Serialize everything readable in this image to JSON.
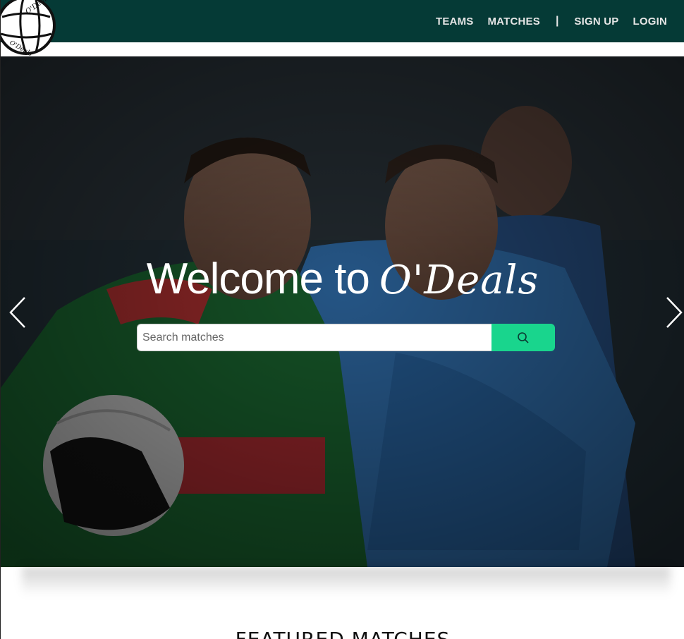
{
  "logo": {
    "icon": "gaelic-football-logo-icon",
    "text": "O'Deals"
  },
  "nav": {
    "items": [
      {
        "label": "TEAMS"
      },
      {
        "label": "MATCHES"
      },
      {
        "label": "SIGN UP"
      },
      {
        "label": "LOGIN"
      }
    ],
    "separator": "|"
  },
  "hero": {
    "welcome": "Welcome to",
    "brand": "O'Deals",
    "search_placeholder": "Search matches",
    "search_value": "",
    "search_icon": "search-icon",
    "prev_icon": "chevron-left-icon",
    "next_icon": "chevron-right-icon"
  },
  "featured": {
    "title": "FEATURED MATCHES"
  },
  "colors": {
    "navbar": "#053a36",
    "search_button": "#19d58d",
    "nav_text": "#e6e6e6"
  }
}
